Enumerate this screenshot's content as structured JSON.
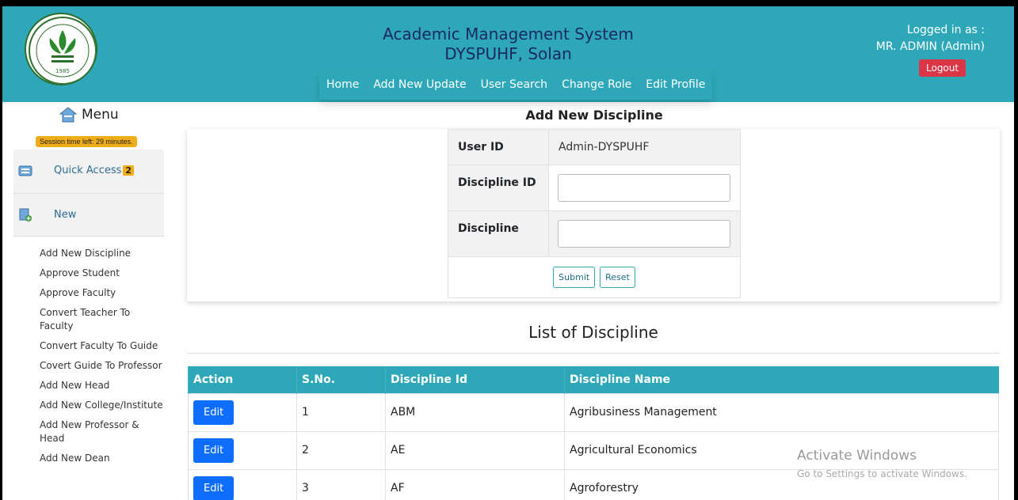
{
  "header": {
    "title_line1": "Academic Management System",
    "title_line2": "DYSPUHF, Solan",
    "nav": [
      "Home",
      "Add New Update",
      "User Search",
      "Change Role",
      "Edit Profile"
    ],
    "logged_in_label": "Logged in as :",
    "logged_in_user": "MR. ADMIN (Admin)",
    "logout_label": "Logout",
    "logo_year": "1985"
  },
  "sidebar": {
    "menu_label": "Menu",
    "session_text": "Session time left: 29 minutes.",
    "quick_access_label": "Quick Access",
    "quick_access_count": "2",
    "new_label": "New",
    "links": [
      "Add New Discipline",
      "Approve Student",
      "Approve Faculty",
      "Convert Teacher To Faculty",
      "Convert Faculty To Guide",
      "Covert Guide To Professor",
      "Add New Head",
      "Add New College/Institute",
      "Add New Professor & Head",
      "Add New Dean"
    ]
  },
  "form": {
    "title": "Add New Discipline",
    "user_id_label": "User ID",
    "user_id_value": "Admin-DYSPUHF",
    "discipline_id_label": "Discipline ID",
    "discipline_id_value": "",
    "discipline_label": "Discipline",
    "discipline_value": "",
    "submit_label": "Submit",
    "reset_label": "Reset"
  },
  "list": {
    "title": "List of Discipline",
    "columns": [
      "Action",
      "S.No.",
      "Discipline Id",
      "Discipline Name"
    ],
    "edit_label": "Edit",
    "rows": [
      {
        "sno": "1",
        "id": "ABM",
        "name": "Agribusiness Management"
      },
      {
        "sno": "2",
        "id": "AE",
        "name": "Agricultural Economics"
      },
      {
        "sno": "3",
        "id": "AF",
        "name": "Agroforestry"
      }
    ]
  },
  "watermark": {
    "line1": "Activate Windows",
    "line2": "Go to Settings to activate Windows."
  },
  "colors": {
    "header_bg": "#2ea8b8",
    "logout_bg": "#dc3545",
    "edit_bg": "#0d6efd",
    "badge_bg": "#f0ad1a"
  }
}
